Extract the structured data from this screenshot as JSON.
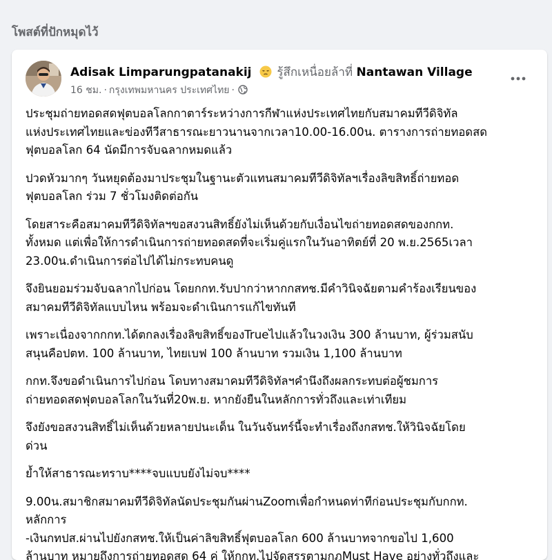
{
  "section": {
    "title": "โพสต์ที่ปักหมุดไว้"
  },
  "post": {
    "author": "Adisak Limparungpatanakij",
    "feeling_emoji": "pensive-face-icon",
    "feeling_text": "รู้สึกเหนื่อยล้าที่",
    "place": "Nantawan Village",
    "time": "16 ชม.",
    "location": "กรุงเทพมหานคร ประเทศไทย",
    "audience_icon": "globe-icon",
    "more_icon": "more-horizontal-icon",
    "paragraphs": [
      "ประชุมถ่ายทอดสดฟุตบอลโลกกาตาร์ระหว่างการกีฬาแห่งประเทศไทยกับสมาคมทีวีดิจิทัล\nแห่งประเทศไทยและข่องทีวีสาธารณะยาวนานจากเวลา10.00-16.00น. ตารางการถ่ายทอดสด\nฟุตบอลโลก 64 นัดมีการจับฉลากหมดแล้ว",
      "ปวดหัวมากๆ วันหยุดต้องมาประชุมในฐานะตัวแทนสมาคมทีวีดิจิทัลฯเรื่องลิขสิทธิ์ถ่ายทอด\nฟุตบอลโลก ร่วม 7 ชั่วโมงติดต่อกัน",
      "โดยสาระคือสมาคมทีวีดิจิทัลฯขอสงวนสิทธิ์ยังไม่เห็นด้วยกับเงื่อนไขถ่ายทอดสดของกกท.\nทั้งหมด แต่เพื่อให้การดำเนินการถ่ายทอดสดที่จะเริ่มคู่แรกในวันอาทิตย์ที่ 20 พ.ย.2565เวลา\n23.00น.ดำเนินการต่อไปได้ไม่กระทบคนดู",
      "จึงยินยอมร่วมจับฉลากไปก่อน โดยกกท.รับปากว่าหากกสทช.มีคำวินิจฉัยตามคำร้องเรียนของ\nสมาคมทีวีดิจิทัลแบบไหน พร้อมจะดำเนินการแก้ไขทันที",
      " เพราะเนื่องจากกกท.ได้ตกลงเรื่องลิขสิทธิ์ของTrueไปแล้วในวงเงิน 300 ล้านบาท, ผู้ร่วมสนับ\nสนุนคือปตท. 100 ล้านบาท, ไทยเบฟ 100 ล้านบาท รวมเงิน 1,100  ล้านบาท",
      "กกท.จึงขอดำเนินการไปก่อน โดบทางสมาคมทีวีดิจิทัลฯคำนึงถึงผลกระทบต่อผู้ชมการ\nถ่ายทอดสดฟุตบอลโลกในวันที่20พ.ย. หากยังยืนในหลักการทั่วถึงและเท่าเทียม",
      "จึงยังขอสงวนสิทธิ์ไม่เห็นด้วยหลายปนะเด็น  ในวันจันทร์นี้จะทำเรื่องถึงกสทช.ให้วินิจฉัยโดย\nด่วน",
      "ย้ำให้สาธารณะทราบ****จบแบบยังไม่จบ****",
      "9.00น.สมาชิกสมาคมทีวีดิจิทัลนัดประชุมกันผ่านZoomเพื่อกำหนดท่าทีก่อนประชุมกับกกท.\nหลักการ\n-เงินกทปส.ผ่านไปยังกสทช.ให้เป็นค่าลิขสิทธิ์ฟุตบอลโลก 600 ล้านบาทจากขอไป 1,600\nล้านบาท หมายถึงการถ่ายทอดสด 64 คู่ ให้กกท.ไปจัดสรรตามกฎMust Have อย่างทั่วถึงและ"
    ]
  }
}
